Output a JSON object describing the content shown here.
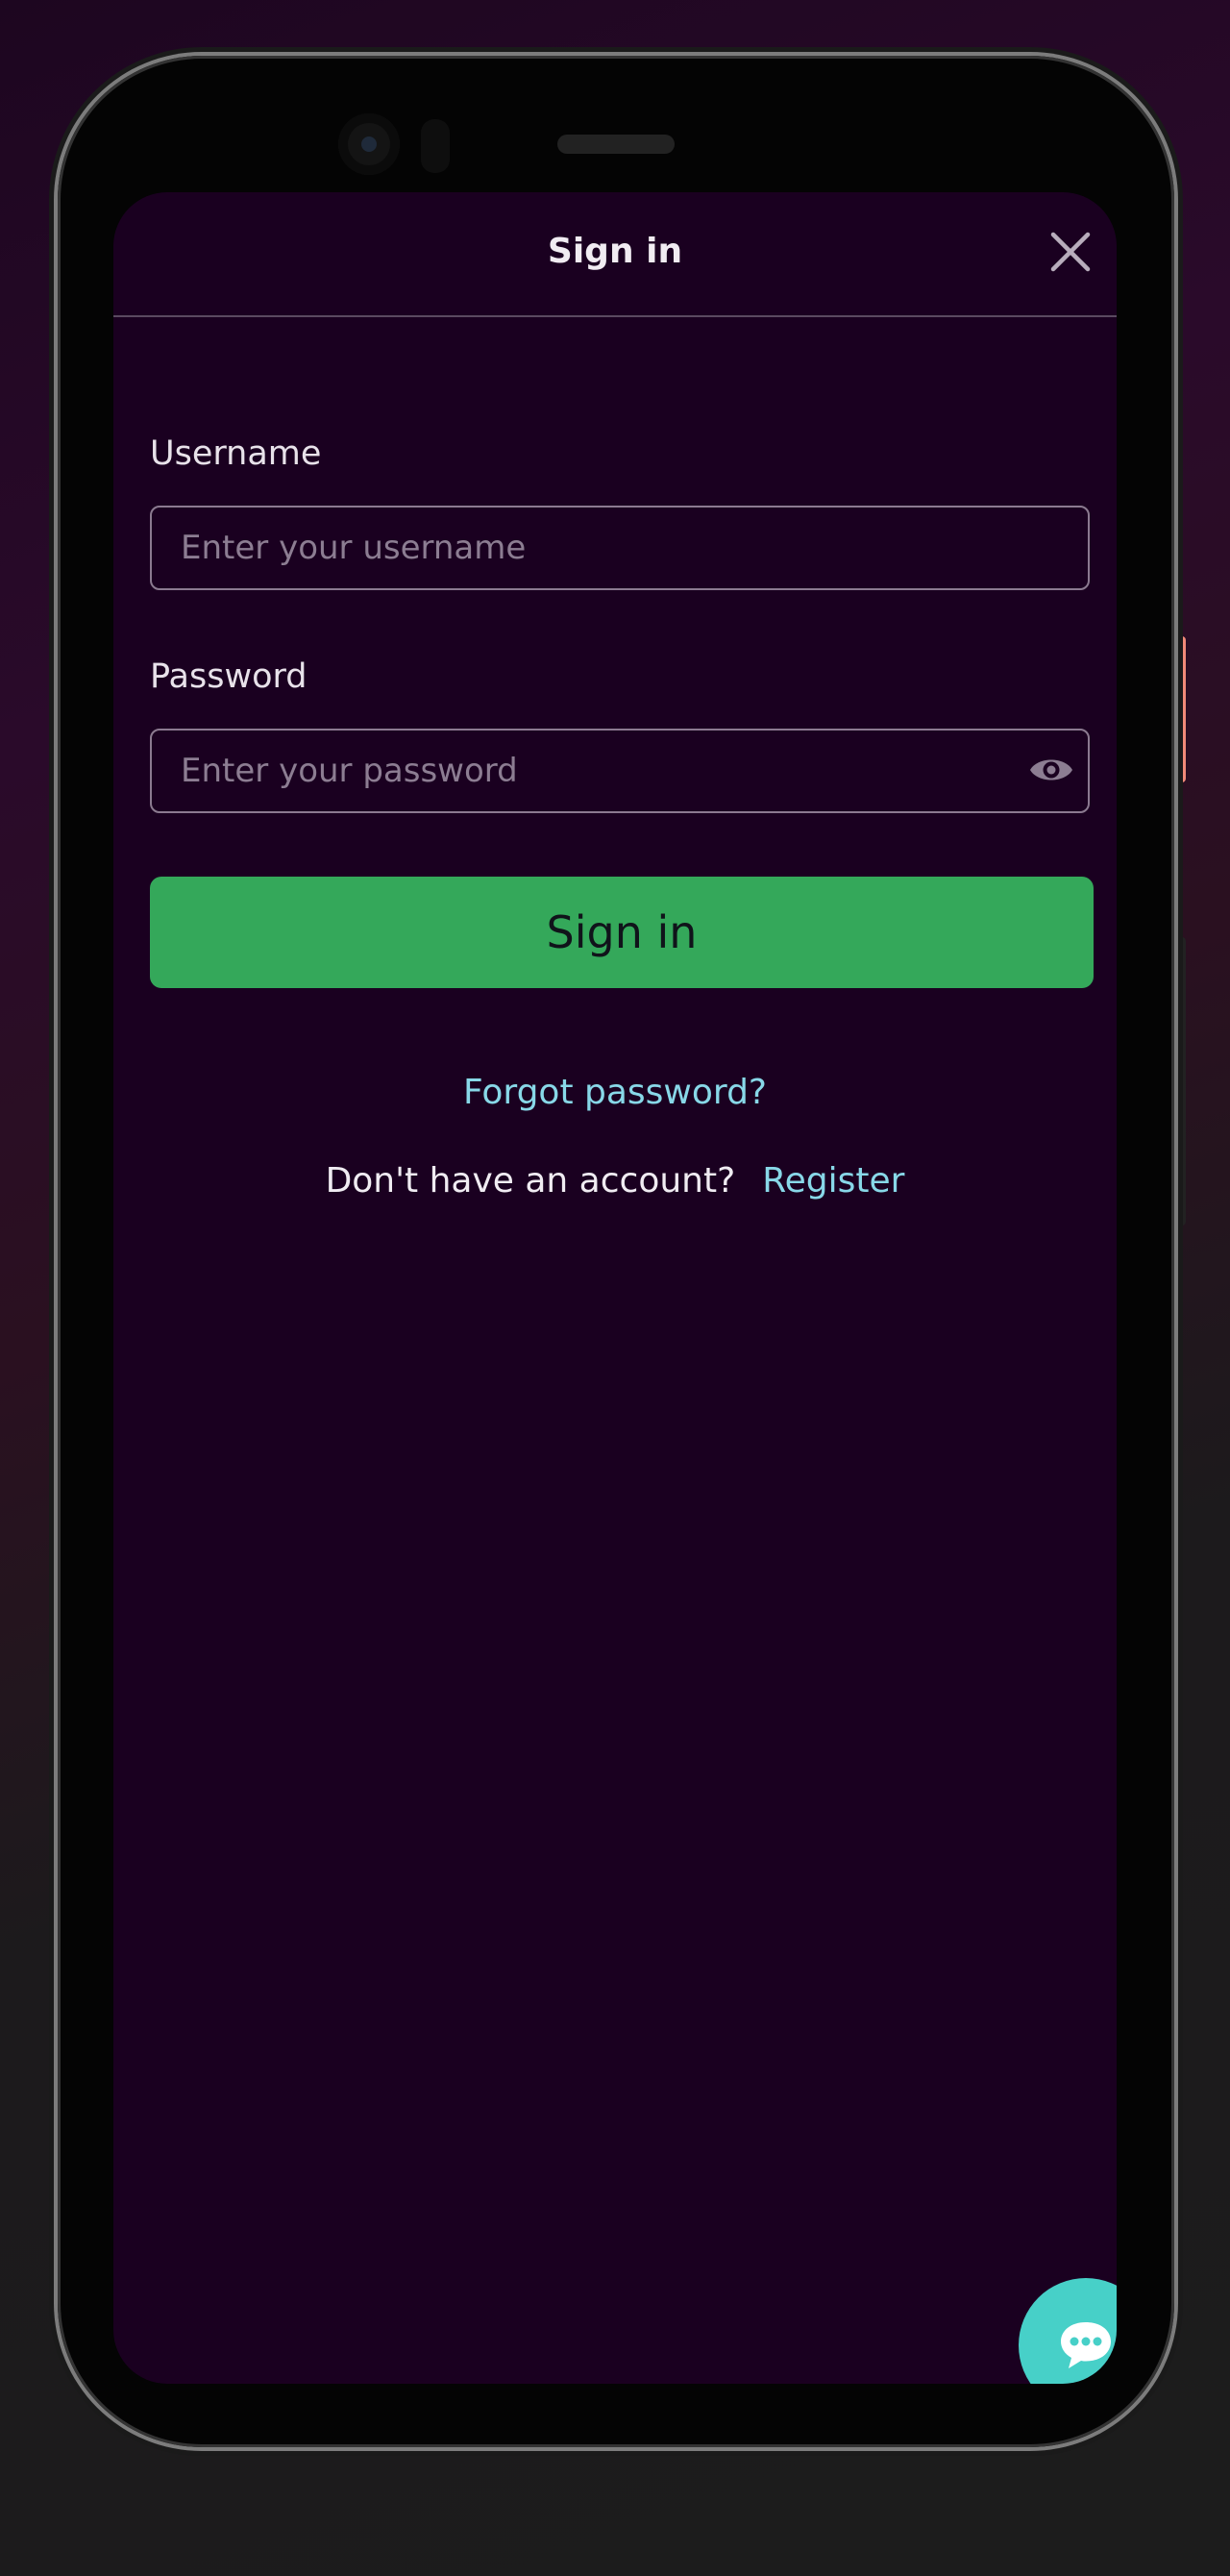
{
  "header": {
    "title": "Sign in",
    "close_icon": "close-icon"
  },
  "form": {
    "username_label": "Username",
    "username_placeholder": "Enter your username",
    "username_value": "",
    "password_label": "Password",
    "password_placeholder": "Enter your password",
    "password_value": "",
    "password_toggle_icon": "eye-icon",
    "submit_label": "Sign in"
  },
  "links": {
    "forgot_password": "Forgot password?",
    "no_account_text": "Don't have an account?",
    "register": "Register"
  },
  "chat": {
    "icon": "chat-icon"
  },
  "colors": {
    "screen_bg": "#1a0020",
    "button_green": "#34a85a",
    "link_cyan": "#88d8e8",
    "chat_teal": "#47d0c8",
    "side_accent": "#f08a78"
  }
}
